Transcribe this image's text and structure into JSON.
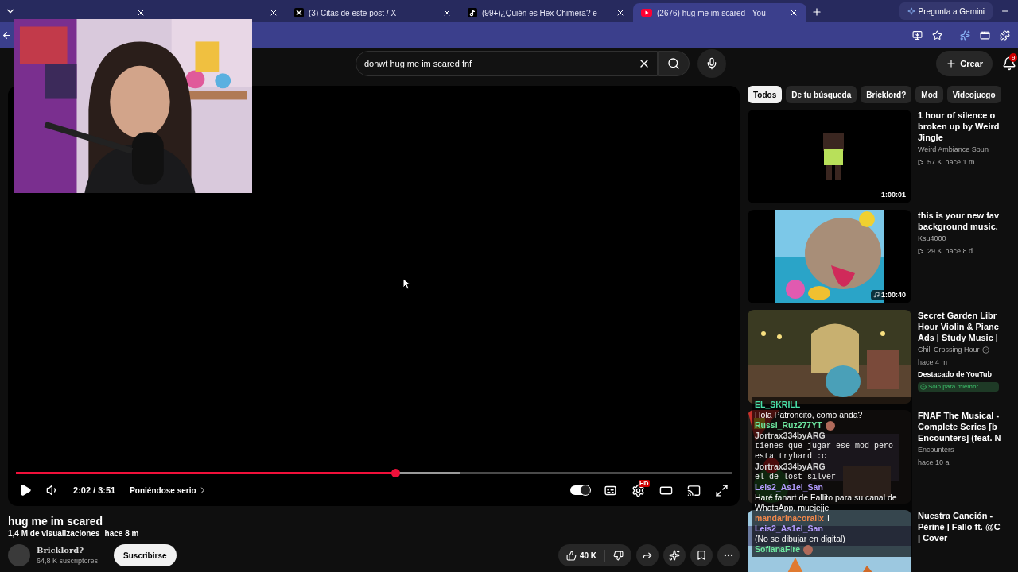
{
  "browser": {
    "tabs": [
      {
        "selected": false
      },
      {
        "selected": false
      },
      {
        "kind": "x",
        "title": "(3) Citas de este post / X",
        "selected": false
      },
      {
        "kind": "tiktok",
        "title": "(99+)¿Quién es Hex Chimera? e",
        "selected": false
      },
      {
        "kind": "youtube",
        "title": "(2676) hug me im scared - You",
        "selected": true
      }
    ],
    "gemini_button": "Pregunta a Gemini"
  },
  "header": {
    "search": {
      "value": "donwt hug me im scared fnf"
    },
    "create_button": "Crear",
    "notification_count": "9"
  },
  "player": {
    "progress": {
      "level": 0.53
    },
    "buffered": {
      "level": 0.62
    },
    "time": "2:02 / 3:51",
    "chapter": "Poniéndose serio",
    "autoplay": true,
    "settings_badge": "HD"
  },
  "video": {
    "title": "hug me im scared",
    "views": "1,4 M de visualizaciones",
    "age": "hace 8 m",
    "channel": "Bricklord?",
    "subscribers": "64,8 K suscriptores",
    "subscribe_button": "Suscribirse",
    "likes": "40 K"
  },
  "chips": [
    {
      "label": "Todos",
      "selected": true
    },
    {
      "label": "De tu búsqueda",
      "selected": false
    },
    {
      "label": "Bricklord?",
      "selected": false
    },
    {
      "label": "Mod",
      "selected": false
    },
    {
      "label": "Videojuego",
      "selected": false
    }
  ],
  "recommendations": [
    {
      "title_lines": [
        "1 hour of silence o",
        "broken up by Weird",
        "Jingle"
      ],
      "channel": "Weird Ambiance Soun",
      "views": "57 K",
      "age": "hace 1 m",
      "duration": "1:00:01",
      "music": false,
      "verified": false
    },
    {
      "title_lines": [
        "this is your new fav",
        "background music."
      ],
      "channel": "Ksu4000",
      "views": "29 K",
      "age": "hace 8 d",
      "duration": "1:00:40",
      "music": true,
      "verified": false
    },
    {
      "title_lines": [
        "Secret Garden Libr",
        "Hour Violin & Pianc",
        "Ads | Study Music |"
      ],
      "channel": "Chill Crossing Hour",
      "verified": true,
      "age": "hace 4 m",
      "featured": "Destacado de YouTub",
      "members": "Solo para miembr"
    },
    {
      "title_lines": [
        "FNAF The Musical -",
        "Complete Series [b",
        "Encounters] (feat. N"
      ],
      "channel": "Encounters",
      "verified": false,
      "age": "hace 10 a"
    },
    {
      "title_lines": [
        "Nuestra Canción -",
        "Périné | Fallo ft. @C",
        "| Cover"
      ]
    }
  ],
  "chat": [
    {
      "user": "EL_SKRILL",
      "color": "#49e0a8",
      "text": "Hola Patroncito, como anda?",
      "kind": "plain",
      "emote": false
    },
    {
      "user": "Russi_Ruz277YT",
      "color": "#6ee7a0",
      "emote": true
    },
    {
      "user": "Jortrax334byARG",
      "color": "#d4d4d4",
      "text": "tienes que jugar ese mod pero esta tryhard :c",
      "kind": "mono",
      "emote": false
    },
    {
      "user": "Jortrax334byARG",
      "color": "#d4d4d4",
      "text": "el de lost silver",
      "kind": "mono",
      "emote": false
    },
    {
      "user": "Leis2_As1el_San",
      "color": "#b39cff",
      "text": "Haré fanart de Fallito para su canal de WhatsApp, muejejje",
      "kind": "plain",
      "emote": false
    },
    {
      "user": "mandarinacoralix",
      "color": "#f2884b",
      "text": "I",
      "kind": "plain",
      "emote": false
    },
    {
      "user": "Leis2_As1el_San",
      "color": "#b39cff",
      "text": "(No se dibujar en digital)",
      "kind": "plain",
      "emote": false
    },
    {
      "user": "SofianaFire",
      "color": "#6ee7a0",
      "emote": true
    }
  ]
}
